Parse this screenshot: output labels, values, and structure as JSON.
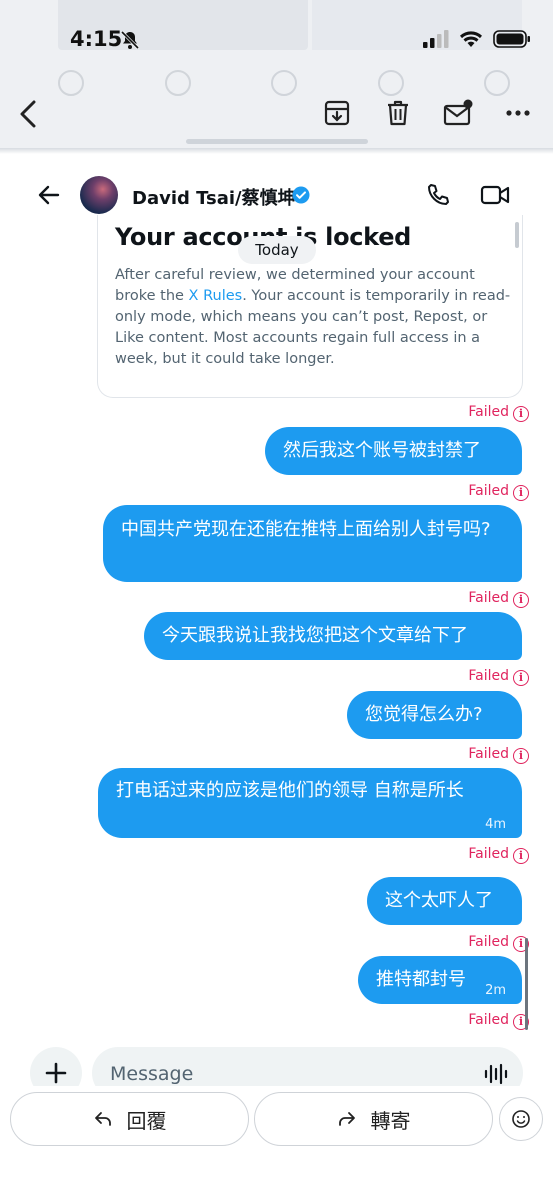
{
  "status_bar": {
    "time": "4:15"
  },
  "chat": {
    "contact_name": "David Tsai/蔡慎坤",
    "today_label": "Today",
    "locked_card": {
      "title": "Your account is locked",
      "body_pre": "After careful review, we determined your account broke the ",
      "body_link": "X Rules",
      "body_post": ". Your account is temporarily in read-only mode, which means you can’t post, Repost, or Like content. Most accounts regain full access in a week, but it could take longer."
    },
    "failed_label": "Failed",
    "messages": [
      {
        "text": "然后我这个账号被封禁了",
        "time": ""
      },
      {
        "text": "中国共产党现在还能在推特上面给别人封号吗?",
        "time": ""
      },
      {
        "text": "今天跟我说让我找您把这个文章给下了",
        "time": ""
      },
      {
        "text": "您觉得怎么办?",
        "time": ""
      },
      {
        "text": "打电话过来的应该是他们的领导 自称是所长",
        "time": "4m"
      },
      {
        "text": "这个太吓人了",
        "time": ""
      },
      {
        "text": "推特都封号",
        "time": "2m"
      }
    ],
    "composer_placeholder": "Message"
  },
  "mail_bar": {
    "reply_label": "回覆",
    "forward_label": "轉寄"
  },
  "colors": {
    "accent": "#1d9bf0",
    "failed": "#e0245e"
  }
}
